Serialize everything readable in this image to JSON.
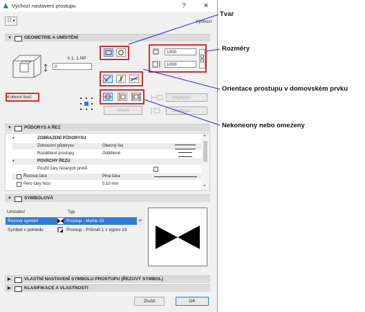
{
  "window": {
    "title": "Výchozí nastavení prostupu",
    "help": "?",
    "close": "✕"
  },
  "toolbar": {
    "default_label": "Výchozí"
  },
  "geometry": {
    "header": "GEOMETRIE A UMÍSTĚNÍ",
    "story_label": "k 1. 1.NP",
    "elevation_value": "0",
    "anchor_label": "Kotevní bod:",
    "width_value": "1000",
    "height_value": "1000",
    "missing_label_1": "Chybějící",
    "missing_label_2": "Chybějící",
    "rotate_label": "Otočit"
  },
  "floor_plan": {
    "header": "PŮDORYS A ŘEZ",
    "rows": [
      {
        "label": "ZOBRAZENÍ PŮDORYSU",
        "value": "",
        "kind": "group-sub"
      },
      {
        "label": "Zobrazení půdorysu",
        "value": "Obecný řez",
        "kind": "item"
      },
      {
        "label": "Rozdělené prostupy",
        "value": "Oddělené",
        "kind": "item"
      },
      {
        "label": "POVRCHY ŘEZU",
        "value": "",
        "kind": "group"
      },
      {
        "label": "Použít čáry řezaných prvků",
        "value": "",
        "kind": "item"
      },
      {
        "label": "Řezová čára",
        "value": "Plná čára",
        "kind": "item"
      },
      {
        "label": "Pero čáry řezu",
        "value": "0,10 mm",
        "kind": "item"
      }
    ]
  },
  "symbol": {
    "header": "SYMBOLOVÁ",
    "col_location": "Umístění",
    "col_type": "Typ",
    "rows": [
      {
        "location": "Řezový symbol",
        "type": "Prostup - Mašle 23"
      },
      {
        "location": "Symbol v pohledu",
        "type": "Prostup - Průmět 1 s výpiní 23"
      }
    ]
  },
  "collapsed_sections": [
    "VLASTNÍ NASTAVENÍ SYMBOLU PROSTUPU (ŘEZOVÝ SYMBOL)",
    "KLASIFIKACE A VLASTNOSTI"
  ],
  "footer": {
    "cancel": "Zrušit",
    "ok": "OK"
  },
  "annotations": {
    "shape": "Tvar",
    "dimensions": "Rozměry",
    "orientation": "Orientace prostupu v domovském prvku",
    "extent": "Nekoneony nebo omezeny"
  },
  "colors": {
    "highlight": "#e0262e",
    "selection": "#2f7ad6",
    "annotation_line": "#1a2dbf"
  }
}
